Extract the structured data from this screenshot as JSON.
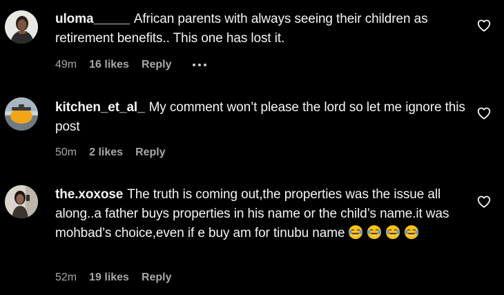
{
  "comments": [
    {
      "username": "uloma_____",
      "text": "African parents with always seeing their children as retirement benefits.. This one has lost it.",
      "time": "49m",
      "likes": "16 likes",
      "reply": "Reply",
      "avatar_icon": "woman-portrait-avatar",
      "show_more_menu": true
    },
    {
      "username": "kitchen_et_al_",
      "text": "My comment won’t please the lord so let me ignore this post",
      "time": "50m",
      "likes": "2 likes",
      "reply": "Reply",
      "avatar_icon": "kitchen-pot-avatar"
    },
    {
      "username": "the.xoxose",
      "text": "The truth is coming out,the properties was the issue all along..a father buys properties in his name or the child’s name.it was mohbad’s choice,even if e buy am for tinubu name",
      "emojis": [
        "😂",
        "😂",
        "😂",
        "😂"
      ],
      "time": "52m",
      "likes": "19 likes",
      "reply": "Reply",
      "avatar_icon": "woman-selfie-avatar"
    }
  ],
  "icons": {
    "like": "heart-outline-icon",
    "more": "more-dots-icon",
    "emoji": "face-with-tears-of-joy-emoji"
  },
  "colors": {
    "background": "#000000",
    "text": "#f5f5f5",
    "meta": "#a8a8a8",
    "emoji_face": "#fcc21b"
  }
}
